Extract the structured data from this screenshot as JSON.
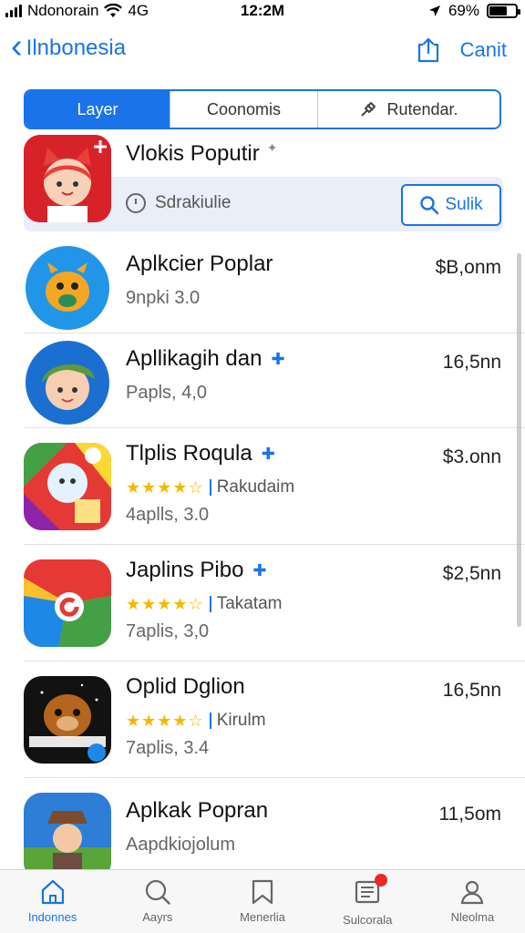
{
  "status_bar": {
    "carrier": "Ndonorain",
    "network": "4G",
    "time": "12:2M",
    "battery": "69%",
    "battery_level": 0.69
  },
  "nav": {
    "back_label": "Ilnbonesia",
    "right_label": "Canit"
  },
  "segments": [
    {
      "label": "Layer"
    },
    {
      "label": "Coonomis"
    },
    {
      "label": "Rutendar."
    }
  ],
  "featured": {
    "title": "Vlokis Poputir",
    "subtitle": "Sdrakiulie",
    "button_label": "Sulik"
  },
  "apps": [
    {
      "name": "Aplkcier Poplar",
      "meta": "9npki 3.0",
      "price": "$B,onm"
    },
    {
      "name": "Apllikagih dan",
      "meta": "Papls, 4,0",
      "price": "16,5nn"
    },
    {
      "name": "Tlplis Roqula",
      "rating_label": "Rakudaim",
      "meta": "4aplls, 3.0",
      "price": "$3.onn",
      "rating": 4.5
    },
    {
      "name": "Japlins Pibo",
      "rating_label": "Takatam",
      "meta": "7aplis, 3,0",
      "price": "$2,5nn",
      "rating": 4.5
    },
    {
      "name": "Oplid Dglion",
      "rating_label": "Kirulm",
      "meta": "7aplis, 3.4",
      "price": "16,5nn",
      "rating": 4.5
    },
    {
      "name": "Aplkak Popran",
      "meta": "Aapdkiojolum",
      "price": "11,5om"
    }
  ],
  "tabs": [
    {
      "label": "Indonnes",
      "icon": "home-icon"
    },
    {
      "label": "Aayrs",
      "icon": "search-icon"
    },
    {
      "label": "Menerlia",
      "icon": "bookmark-icon"
    },
    {
      "label": "Sulcorala",
      "icon": "news-icon"
    },
    {
      "label": "Nleolma",
      "icon": "profile-icon"
    }
  ],
  "colors": {
    "accent": "#1a73e8",
    "badge": "#e52b2b",
    "star": "#f5b800"
  }
}
